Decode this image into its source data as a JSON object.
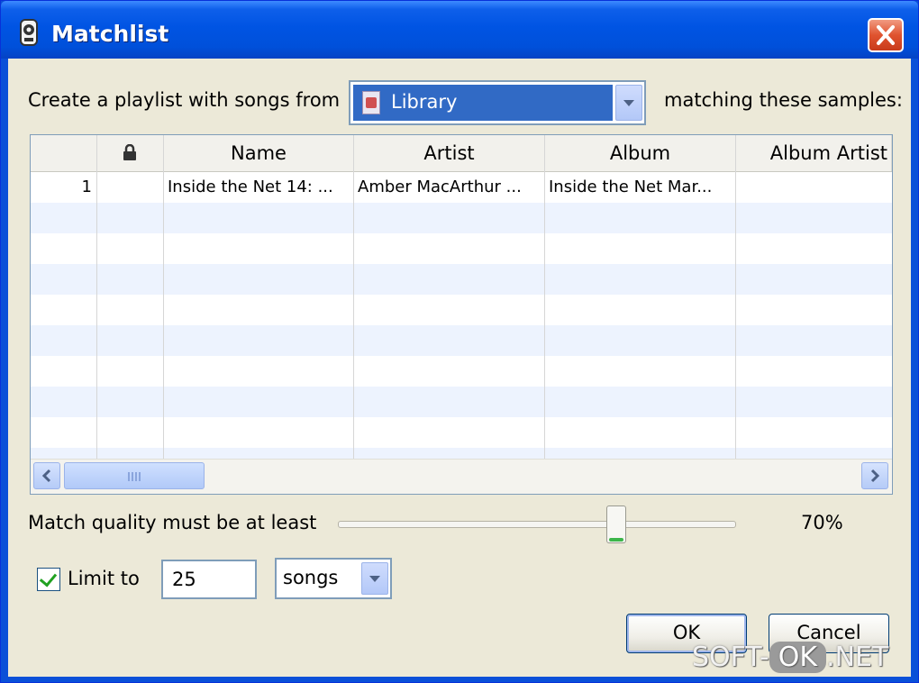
{
  "window": {
    "title": "Matchlist"
  },
  "prompt": {
    "before": "Create a playlist with songs from",
    "after": "matching these samples:",
    "source_selected": "Library"
  },
  "table": {
    "columns": [
      "",
      "",
      "Name",
      "Artist",
      "Album",
      "Album Artist"
    ],
    "rows": [
      {
        "index": "1",
        "locked": "",
        "name": "Inside the Net 14: ...",
        "artist": "Amber MacArthur ...",
        "album": "Inside the Net Mar...",
        "album_artist": ""
      }
    ],
    "scroll_grip": "III"
  },
  "quality": {
    "label": "Match quality must be at least",
    "value_text": "70%",
    "value": 0.7
  },
  "limit": {
    "checked": true,
    "label": "Limit to",
    "value": "25",
    "unit": "songs"
  },
  "buttons": {
    "ok": "OK",
    "cancel": "Cancel"
  },
  "watermark": {
    "left": "SOFT-",
    "mid": "OK",
    "right": ".NET"
  },
  "colors": {
    "title_bar": "#0054e3",
    "selection": "#316ac5",
    "close": "#e0532f",
    "slider_accent": "#3cb64a"
  }
}
